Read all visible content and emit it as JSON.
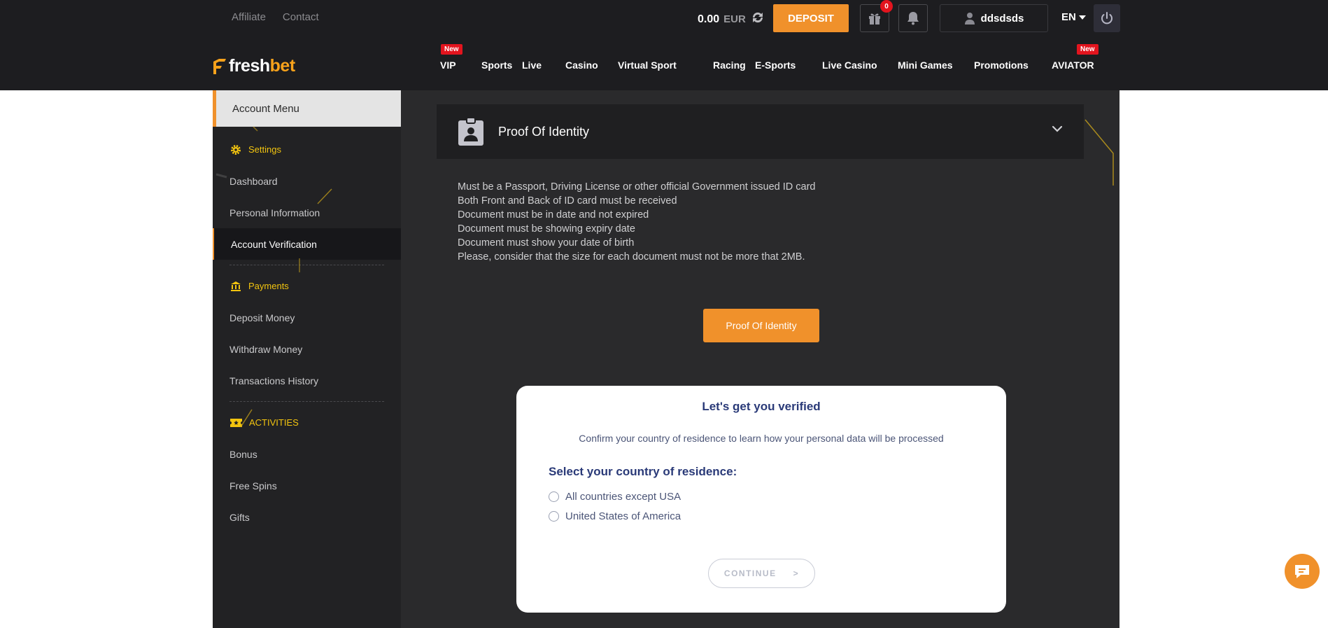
{
  "header": {
    "top_links": [
      "Affiliate",
      "Contact"
    ],
    "balance": "0.00",
    "currency": "EUR",
    "deposit_label": "DEPOSIT",
    "gift_count": "0",
    "username": "ddsdsds",
    "language": "EN",
    "logo": {
      "fresh": "fresh",
      "bet": "bet"
    },
    "nav": [
      {
        "label": "VIP",
        "badge": "New"
      },
      {
        "label": "Sports",
        "badge": ""
      },
      {
        "label": "Live",
        "badge": ""
      },
      {
        "label": "Casino",
        "badge": ""
      },
      {
        "label": "Virtual Sport",
        "badge": ""
      },
      {
        "label": "Racing",
        "badge": ""
      },
      {
        "label": "E-Sports",
        "badge": ""
      },
      {
        "label": "Live Casino",
        "badge": ""
      },
      {
        "label": "Mini Games",
        "badge": ""
      },
      {
        "label": "Promotions",
        "badge": ""
      },
      {
        "label": "AVIATOR",
        "badge": "New"
      }
    ]
  },
  "sidebar": {
    "title": "Account Menu",
    "sections": [
      {
        "title": "Settings",
        "items": [
          "Dashboard",
          "Personal Information",
          "Account Verification"
        ]
      },
      {
        "title": "Payments",
        "items": [
          "Deposit Money",
          "Withdraw Money",
          "Transactions History"
        ]
      },
      {
        "title": "ACTIVITIES",
        "items": [
          "Bonus",
          "Free Spins",
          "Gifts"
        ]
      }
    ],
    "active_item": "Account Verification"
  },
  "main": {
    "section_title": "Proof Of Identity",
    "requirements": [
      "Must be a Passport, Driving License or other official Government issued ID card",
      "Both Front and Back of ID card must be received",
      "Document must be in date and not expired",
      "Document must be showing expiry date",
      "Document must show your date of birth",
      "Please, consider that the size for each document must not be more that 2MB."
    ],
    "proof_button": "Proof Of Identity",
    "verify": {
      "title": "Let's get you verified",
      "subtitle": "Confirm your country of residence to learn how your personal data will be processed",
      "question": "Select your country of residence:",
      "options": [
        "All countries except USA",
        "United States of America"
      ],
      "continue_label": "CONTINUE",
      "continue_arrow": ">"
    }
  },
  "colors": {
    "accent": "#f0912b",
    "header_bg": "#1d1d20",
    "sidebar_bg": "#222224",
    "main_bg": "#2a2a2c",
    "section_yellow": "#f2c40f",
    "verify_title": "#2a3a78"
  },
  "icons": [
    "refresh-icon",
    "gift-icon",
    "bell-icon",
    "user-icon",
    "caret-down-icon",
    "power-icon",
    "logo-icon",
    "gear-icon",
    "bank-icon",
    "ticket-icon",
    "id-card-icon",
    "chevron-down-icon",
    "chat-icon"
  ]
}
